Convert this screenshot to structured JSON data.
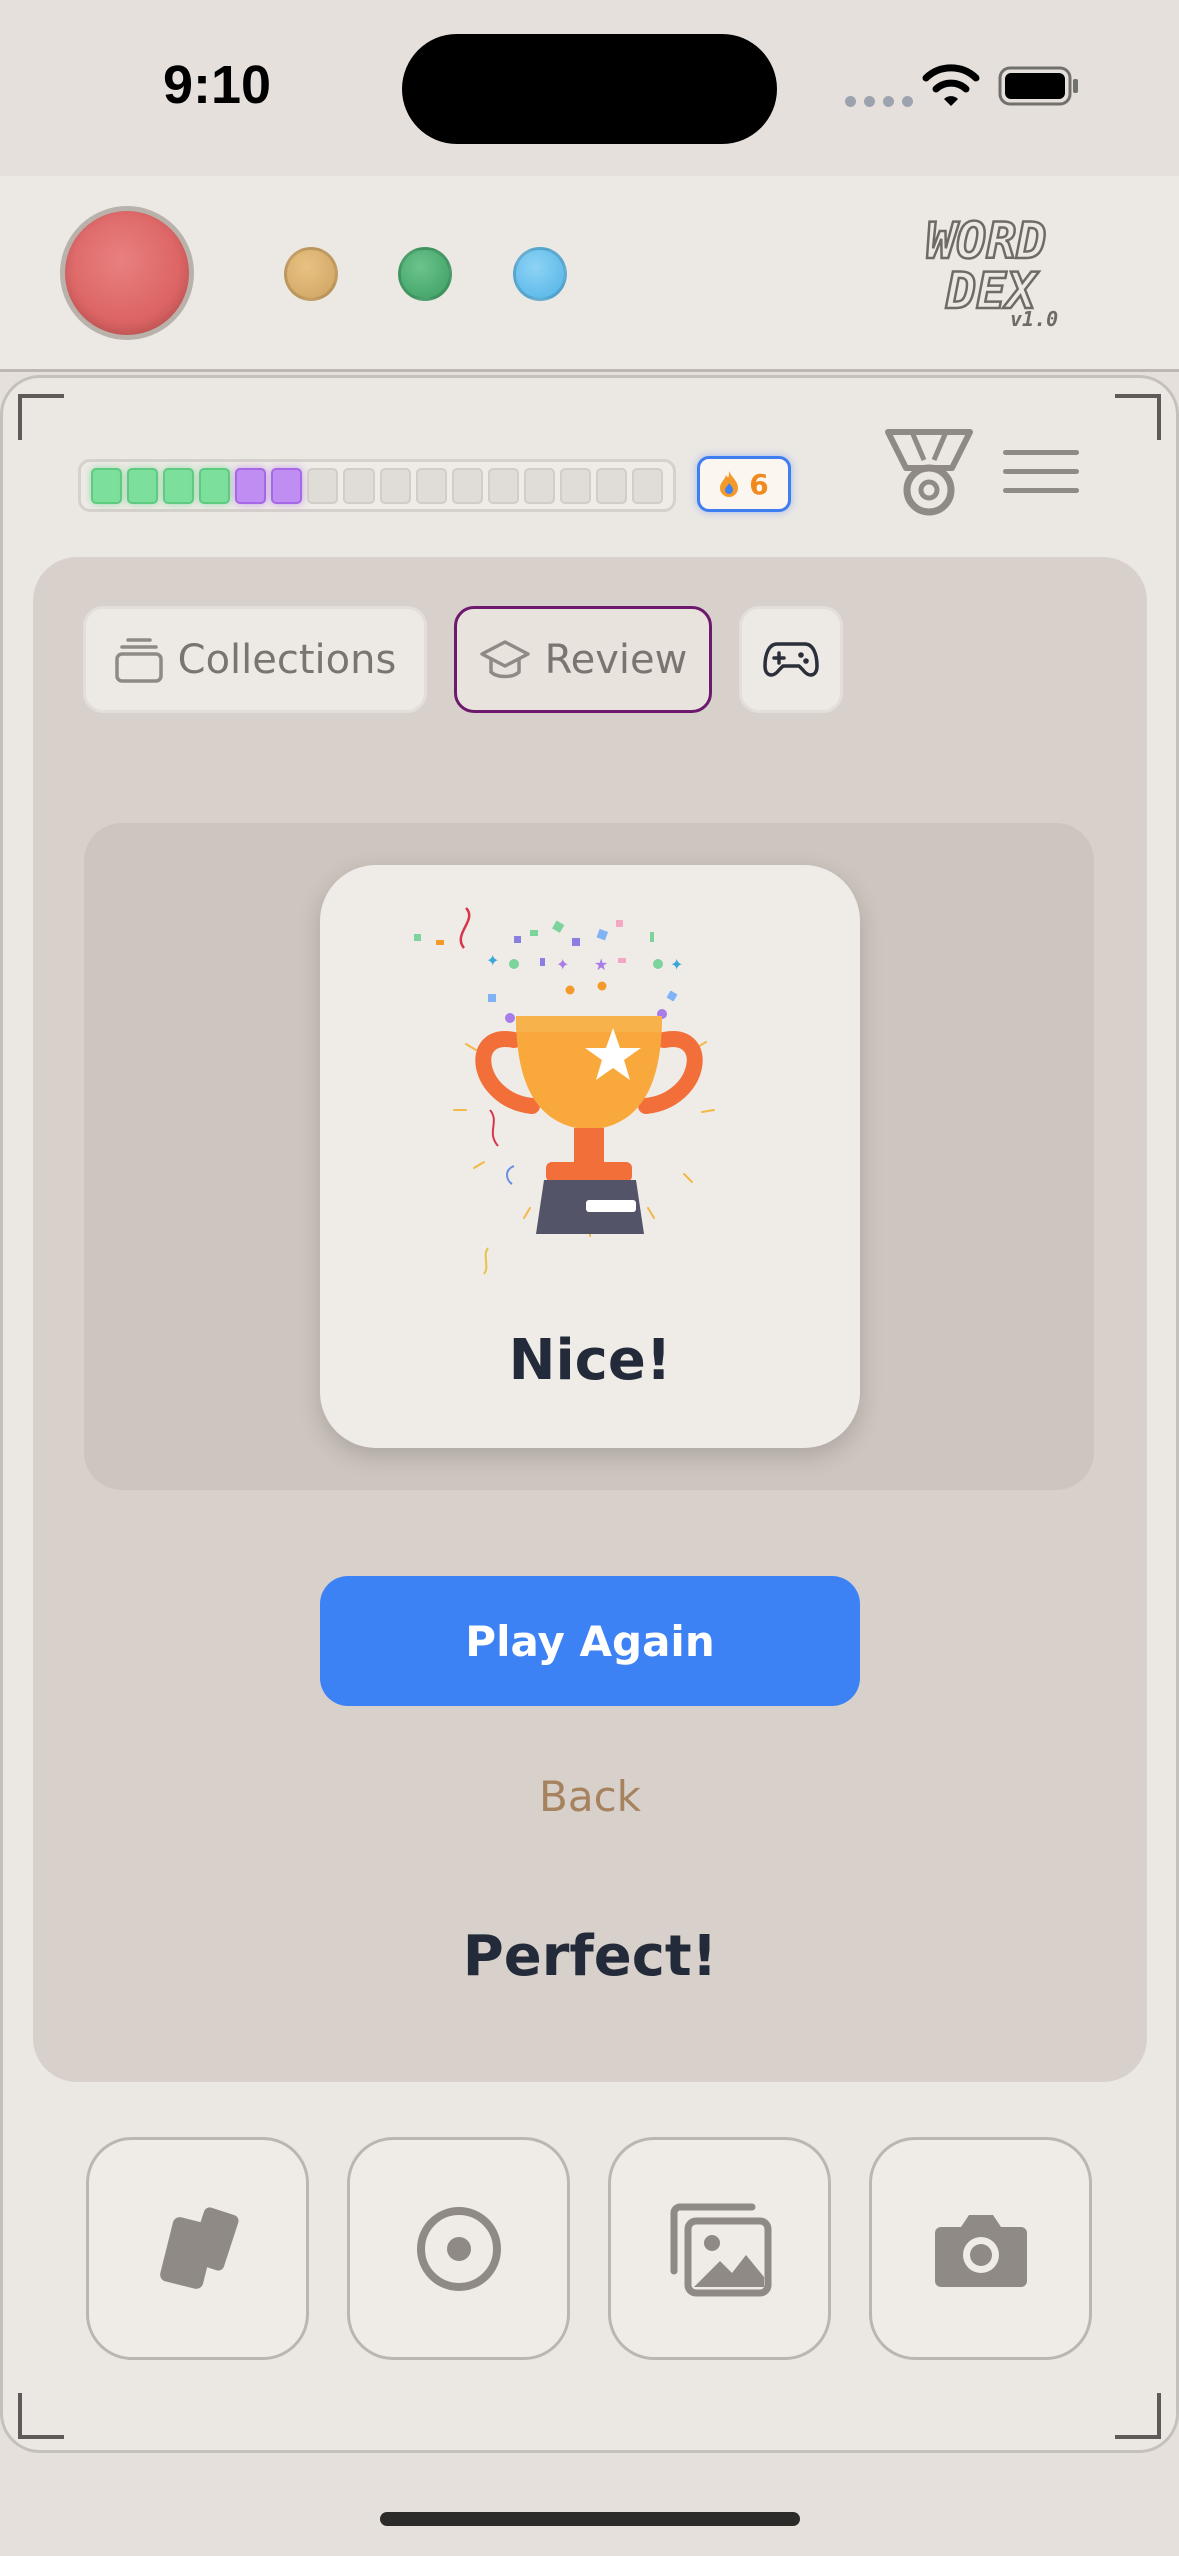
{
  "status_bar": {
    "time": "9:10"
  },
  "logo": {
    "line1": "WORD",
    "line2": "DEX",
    "version": "v1.0"
  },
  "progress": {
    "total_segments": 16,
    "green_segments": 4,
    "purple_segments": 2
  },
  "streak": {
    "count": "6",
    "icon": "flame-icon"
  },
  "tabs": [
    {
      "label": "Collections",
      "icon": "cards-stack-icon"
    },
    {
      "label": "Review",
      "icon": "graduation-cap-icon",
      "active": true
    },
    {
      "label": "",
      "icon": "gamepad-icon"
    }
  ],
  "result_card": {
    "title": "Nice!"
  },
  "actions": {
    "play_again": "Play Again",
    "back": "Back"
  },
  "summary": {
    "text": "Perfect!"
  },
  "bottom_nav": [
    "cards-icon",
    "record-icon",
    "gallery-icon",
    "camera-icon"
  ],
  "colors": {
    "accent_blue": "#3d82f5",
    "review_border": "#6d1a6e",
    "streak_orange": "#f08a1d",
    "back_link": "#a7825f"
  }
}
